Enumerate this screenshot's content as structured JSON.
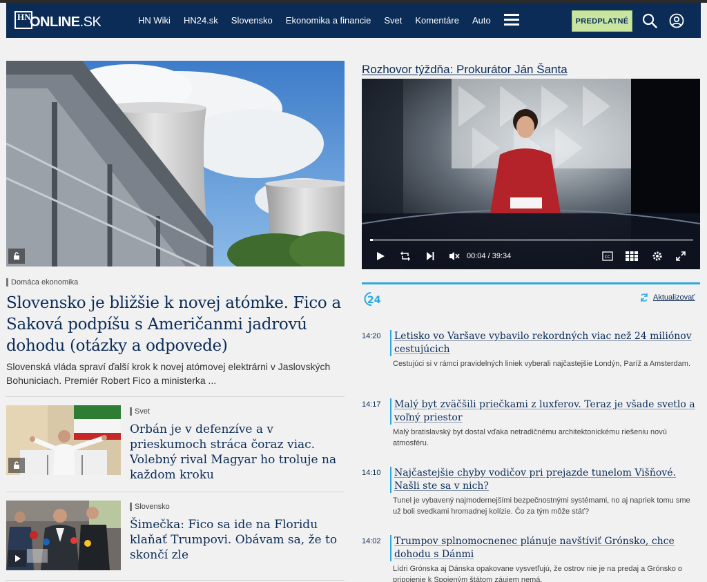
{
  "header": {
    "logo_hn": "HN",
    "logo_online": "ONLINE",
    "logo_sk": ".SK",
    "nav": [
      "HN Wiki",
      "HN24.sk",
      "Slovensko",
      "Ekonomika a financie",
      "Svet",
      "Komentáre",
      "Auto"
    ],
    "subscribe_label": "PREDPLATNÉ"
  },
  "lead": {
    "category": "Domáca ekonomika",
    "title": "Slovensko je bližšie k novej atómke. Fico a Saková podpíšu s Američanmi jadrovú dohodu (otázky a odpovede)",
    "perex": "Slovenská vláda spraví ďalší krok k novej atómovej elektrárni v Jaslovských Bohuniciach. Premiér Robert Fico a ministerka ..."
  },
  "articles": [
    {
      "category": "Svet",
      "title": "Orbán je v defenzíve a v prieskumoch stráca čoraz viac. Volebný rival Magyar ho troluje na každom kroku"
    },
    {
      "category": "Slovensko",
      "title": "Šimečka: Fico sa ide na Floridu klaňať Trumpovi. Obávam sa, že to skončí zle"
    }
  ],
  "video": {
    "heading": "Rozhovor týždňa: Prokurátor Ján Šanta",
    "time_current": "00:04",
    "time_sep": "/",
    "time_total": "39:34",
    "progress": 0.002
  },
  "feed": {
    "refresh_label": "Aktualizovať",
    "items": [
      {
        "time": "14:20",
        "title": "Letisko vo Varšave vybavilo rekordných viac než 24 miliónov cestujúcich",
        "text": "Cestujúci si v rámci pravidelných liniek vyberali najčastejšie Londýn, Paríž a Amsterdam."
      },
      {
        "time": "14:17",
        "title": "Malý byt zväčšili priečkami z luxferov. Teraz je všade svetlo a voľný priestor",
        "text": "Malý bratislavský byt dostal vďaka netradičnému architektonickému riešeniu novú atmosféru."
      },
      {
        "time": "14:10",
        "title": "Najčastejšie chyby vodičov pri prejazde tunelom Višňové. Našli ste sa v nich?",
        "text": "Tunel je vybavený najmodernejšími bezpečnostnými systémami, no aj napriek tomu sme už boli svedkami hromadnej kolízie. Čo za tým môže stáť?"
      },
      {
        "time": "14:02",
        "title": "Trumpov splnomocnenec plánuje navštíviť Grónsko, chce dohodu s Dánmi",
        "text": "Lídri Grónska aj Dánska opakovane vysvetľujú, že ostrov nie je na predaj a Grónsko o pripojenie k Spojeným štátom záujem nemá."
      }
    ]
  }
}
